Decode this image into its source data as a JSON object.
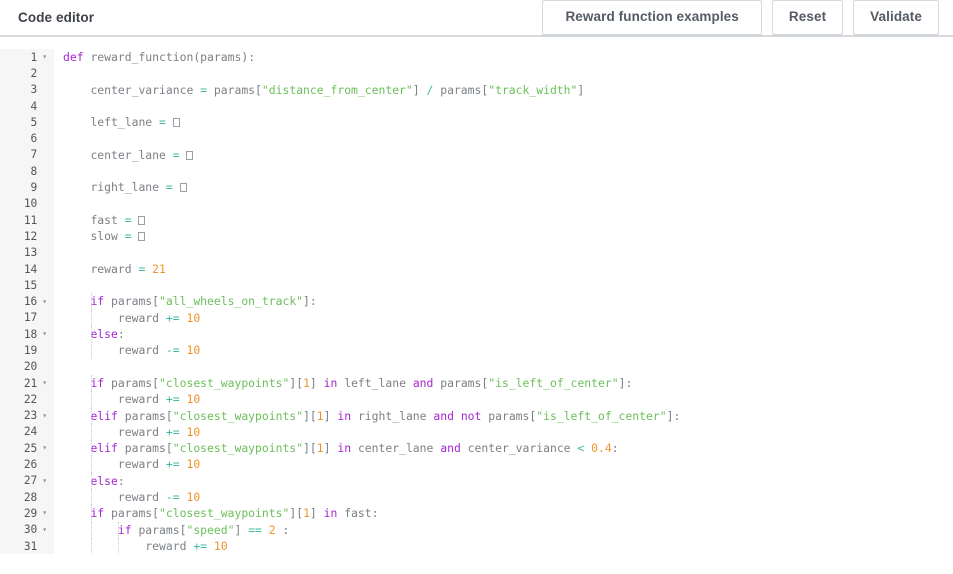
{
  "header": {
    "title": "Code editor",
    "buttons": [
      {
        "label": "Reward function examples",
        "name": "reward-function-examples-button"
      },
      {
        "label": "Reset",
        "name": "reset-button"
      },
      {
        "label": "Validate",
        "name": "validate-button"
      }
    ]
  },
  "editor": {
    "language": "python",
    "colors": {
      "keyword": "#a626d4",
      "string": "#6bbf59",
      "number": "#f0922b",
      "operator": "#3fb9a2",
      "identifier": "#7c8186",
      "gutter_background": "#f6f6f6",
      "button_border": "#d5dbdb",
      "title_text": "#3f4349"
    },
    "first_visible_line": 1,
    "last_visible_line": 31,
    "lines": [
      {
        "n": 1,
        "fold": true,
        "indent": 0,
        "text": "def reward_function(params):"
      },
      {
        "n": 2,
        "fold": false,
        "indent": 0,
        "text": ""
      },
      {
        "n": 3,
        "fold": false,
        "indent": 0,
        "text": "    center_variance = params[\"distance_from_center\"] / params[\"track_width\"]"
      },
      {
        "n": 4,
        "fold": false,
        "indent": 0,
        "text": ""
      },
      {
        "n": 5,
        "fold": false,
        "indent": 0,
        "text": "    left_lane = []"
      },
      {
        "n": 6,
        "fold": false,
        "indent": 0,
        "text": ""
      },
      {
        "n": 7,
        "fold": false,
        "indent": 0,
        "text": "    center_lane = []"
      },
      {
        "n": 8,
        "fold": false,
        "indent": 0,
        "text": ""
      },
      {
        "n": 9,
        "fold": false,
        "indent": 0,
        "text": "    right_lane = []"
      },
      {
        "n": 10,
        "fold": false,
        "indent": 0,
        "text": ""
      },
      {
        "n": 11,
        "fold": false,
        "indent": 0,
        "text": "    fast = []"
      },
      {
        "n": 12,
        "fold": false,
        "indent": 0,
        "text": "    slow = []"
      },
      {
        "n": 13,
        "fold": false,
        "indent": 0,
        "text": ""
      },
      {
        "n": 14,
        "fold": false,
        "indent": 0,
        "text": "    reward = 21"
      },
      {
        "n": 15,
        "fold": false,
        "indent": 0,
        "text": ""
      },
      {
        "n": 16,
        "fold": true,
        "indent": 1,
        "text": "    if params[\"all_wheels_on_track\"]:"
      },
      {
        "n": 17,
        "fold": false,
        "indent": 1,
        "text": "        reward += 10"
      },
      {
        "n": 18,
        "fold": true,
        "indent": 1,
        "text": "    else:"
      },
      {
        "n": 19,
        "fold": false,
        "indent": 1,
        "text": "        reward -= 10"
      },
      {
        "n": 20,
        "fold": false,
        "indent": 0,
        "text": ""
      },
      {
        "n": 21,
        "fold": true,
        "indent": 1,
        "text": "    if params[\"closest_waypoints\"][1] in left_lane and params[\"is_left_of_center\"]:"
      },
      {
        "n": 22,
        "fold": false,
        "indent": 1,
        "text": "        reward += 10"
      },
      {
        "n": 23,
        "fold": true,
        "indent": 1,
        "text": "    elif params[\"closest_waypoints\"][1] in right_lane and not params[\"is_left_of_center\"]:"
      },
      {
        "n": 24,
        "fold": false,
        "indent": 1,
        "text": "        reward += 10"
      },
      {
        "n": 25,
        "fold": true,
        "indent": 1,
        "text": "    elif params[\"closest_waypoints\"][1] in center_lane and center_variance < 0.4:"
      },
      {
        "n": 26,
        "fold": false,
        "indent": 1,
        "text": "        reward += 10"
      },
      {
        "n": 27,
        "fold": true,
        "indent": 1,
        "text": "    else:"
      },
      {
        "n": 28,
        "fold": false,
        "indent": 1,
        "text": "        reward -= 10"
      },
      {
        "n": 29,
        "fold": true,
        "indent": 1,
        "text": "    if params[\"closest_waypoints\"][1] in fast:"
      },
      {
        "n": 30,
        "fold": true,
        "indent": 2,
        "text": "        if params[\"speed\"] == 2 :"
      },
      {
        "n": 31,
        "fold": false,
        "indent": 2,
        "text": "            reward += 10"
      }
    ]
  }
}
